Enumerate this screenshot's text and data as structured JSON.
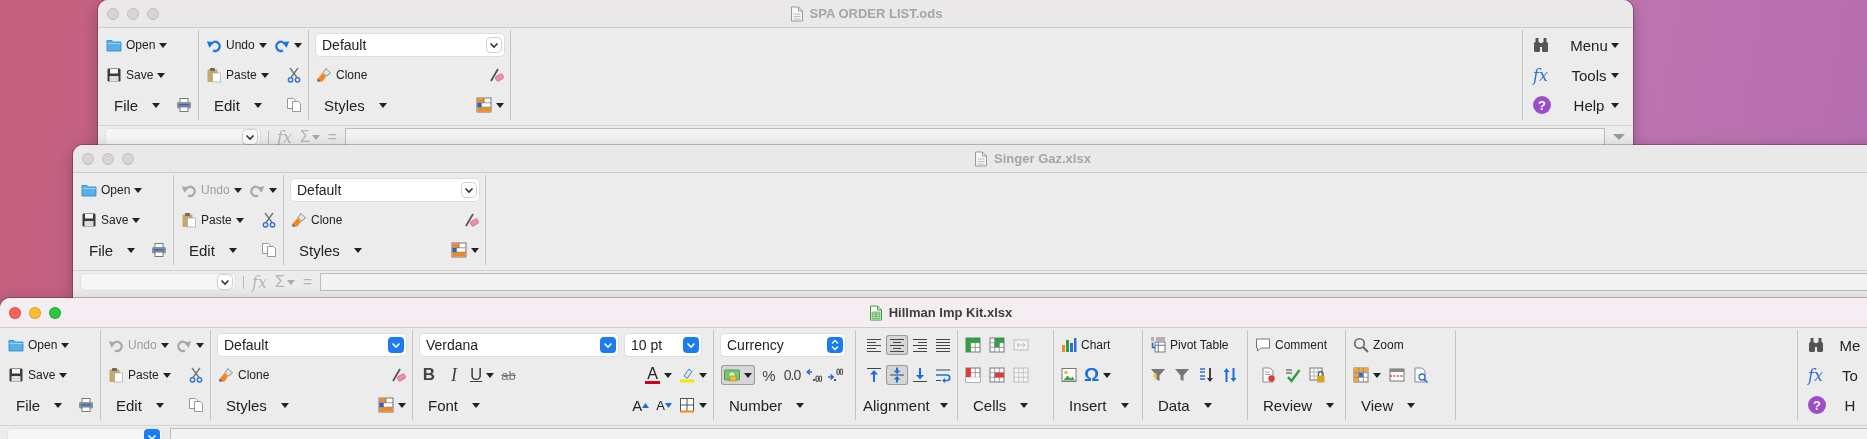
{
  "windows": [
    {
      "title": "SPA ORDER LIST.ods",
      "active": false,
      "groups": [
        {
          "kind": "file",
          "label": "File",
          "open": "Open",
          "save": "Save"
        },
        {
          "kind": "edit",
          "label": "Edit",
          "undo": {
            "label": "Undo",
            "disabled": false
          },
          "redo": {
            "disabled": false
          },
          "paste": "Paste"
        },
        {
          "kind": "styles",
          "label": "Styles",
          "style": "Default",
          "clone": "Clone"
        },
        {
          "kind": "menu",
          "clipped": false,
          "items": [
            {
              "kind": "menu",
              "label": "Menu"
            },
            {
              "kind": "tools",
              "label": "Tools",
              "symbol": "fx"
            },
            {
              "kind": "help",
              "label": "Help",
              "symbol": "?"
            }
          ]
        }
      ],
      "formula_bar": {
        "symbols": [
          "fx",
          "Σ",
          "="
        ]
      }
    },
    {
      "title": "Singer Gaz.xlsx",
      "active": false,
      "groups": [
        {
          "kind": "file",
          "label": "File",
          "open": "Open",
          "save": "Save"
        },
        {
          "kind": "edit",
          "label": "Edit",
          "undo": {
            "label": "Undo",
            "disabled": true
          },
          "redo": {
            "disabled": true
          },
          "paste": "Paste"
        },
        {
          "kind": "styles",
          "label": "Styles",
          "style": "Default",
          "clone": "Clone"
        }
      ],
      "formula_bar": {
        "symbols": [
          "fx",
          "Σ",
          "="
        ]
      }
    },
    {
      "title": "Hillman Imp Kit.xlsx",
      "active": true,
      "groups": [
        {
          "kind": "file",
          "label": "File",
          "open": "Open",
          "save": "Save"
        },
        {
          "kind": "edit",
          "label": "Edit",
          "undo": {
            "label": "Undo",
            "disabled": true
          },
          "redo": {
            "disabled": true
          },
          "paste": "Paste"
        },
        {
          "kind": "styles",
          "label": "Styles",
          "style": "Default",
          "clone": "Clone"
        },
        {
          "kind": "font",
          "label": "Font",
          "font": "Verdana",
          "size": "10 pt",
          "bold": "B",
          "italic": "I",
          "underline": "U",
          "strikethrough": "ab",
          "font_color": "A",
          "grow": "A",
          "shrink": "A"
        },
        {
          "kind": "number",
          "label": "Number",
          "format": "Currency",
          "currency_selected": true,
          "percent": "%",
          "standard": "0.0"
        },
        {
          "kind": "alignment",
          "label": "Alignment",
          "buttons": [
            {
              "selected": false
            },
            {
              "selected": true
            },
            {
              "selected": false
            },
            {
              "selected": false
            },
            {
              "selected": false
            },
            {
              "selected": true
            },
            {
              "selected": false
            },
            {
              "selected": false
            }
          ]
        },
        {
          "kind": "cells",
          "label": "Cells"
        },
        {
          "kind": "insert",
          "label": "Insert",
          "chart": "Chart",
          "special_character": "Ω"
        },
        {
          "kind": "data",
          "label": "Data",
          "pivot": "Pivot Table"
        },
        {
          "kind": "review",
          "label": "Review",
          "comment": "Comment"
        },
        {
          "kind": "view",
          "label": "View",
          "zoom": "Zoom"
        },
        {
          "kind": "menu",
          "clipped": true,
          "items": [
            {
              "kind": "menu",
              "label": "Me"
            },
            {
              "kind": "tools",
              "label": "To",
              "symbol": "fx"
            },
            {
              "kind": "help",
              "label": "H",
              "symbol": "?"
            }
          ]
        }
      ]
    }
  ]
}
